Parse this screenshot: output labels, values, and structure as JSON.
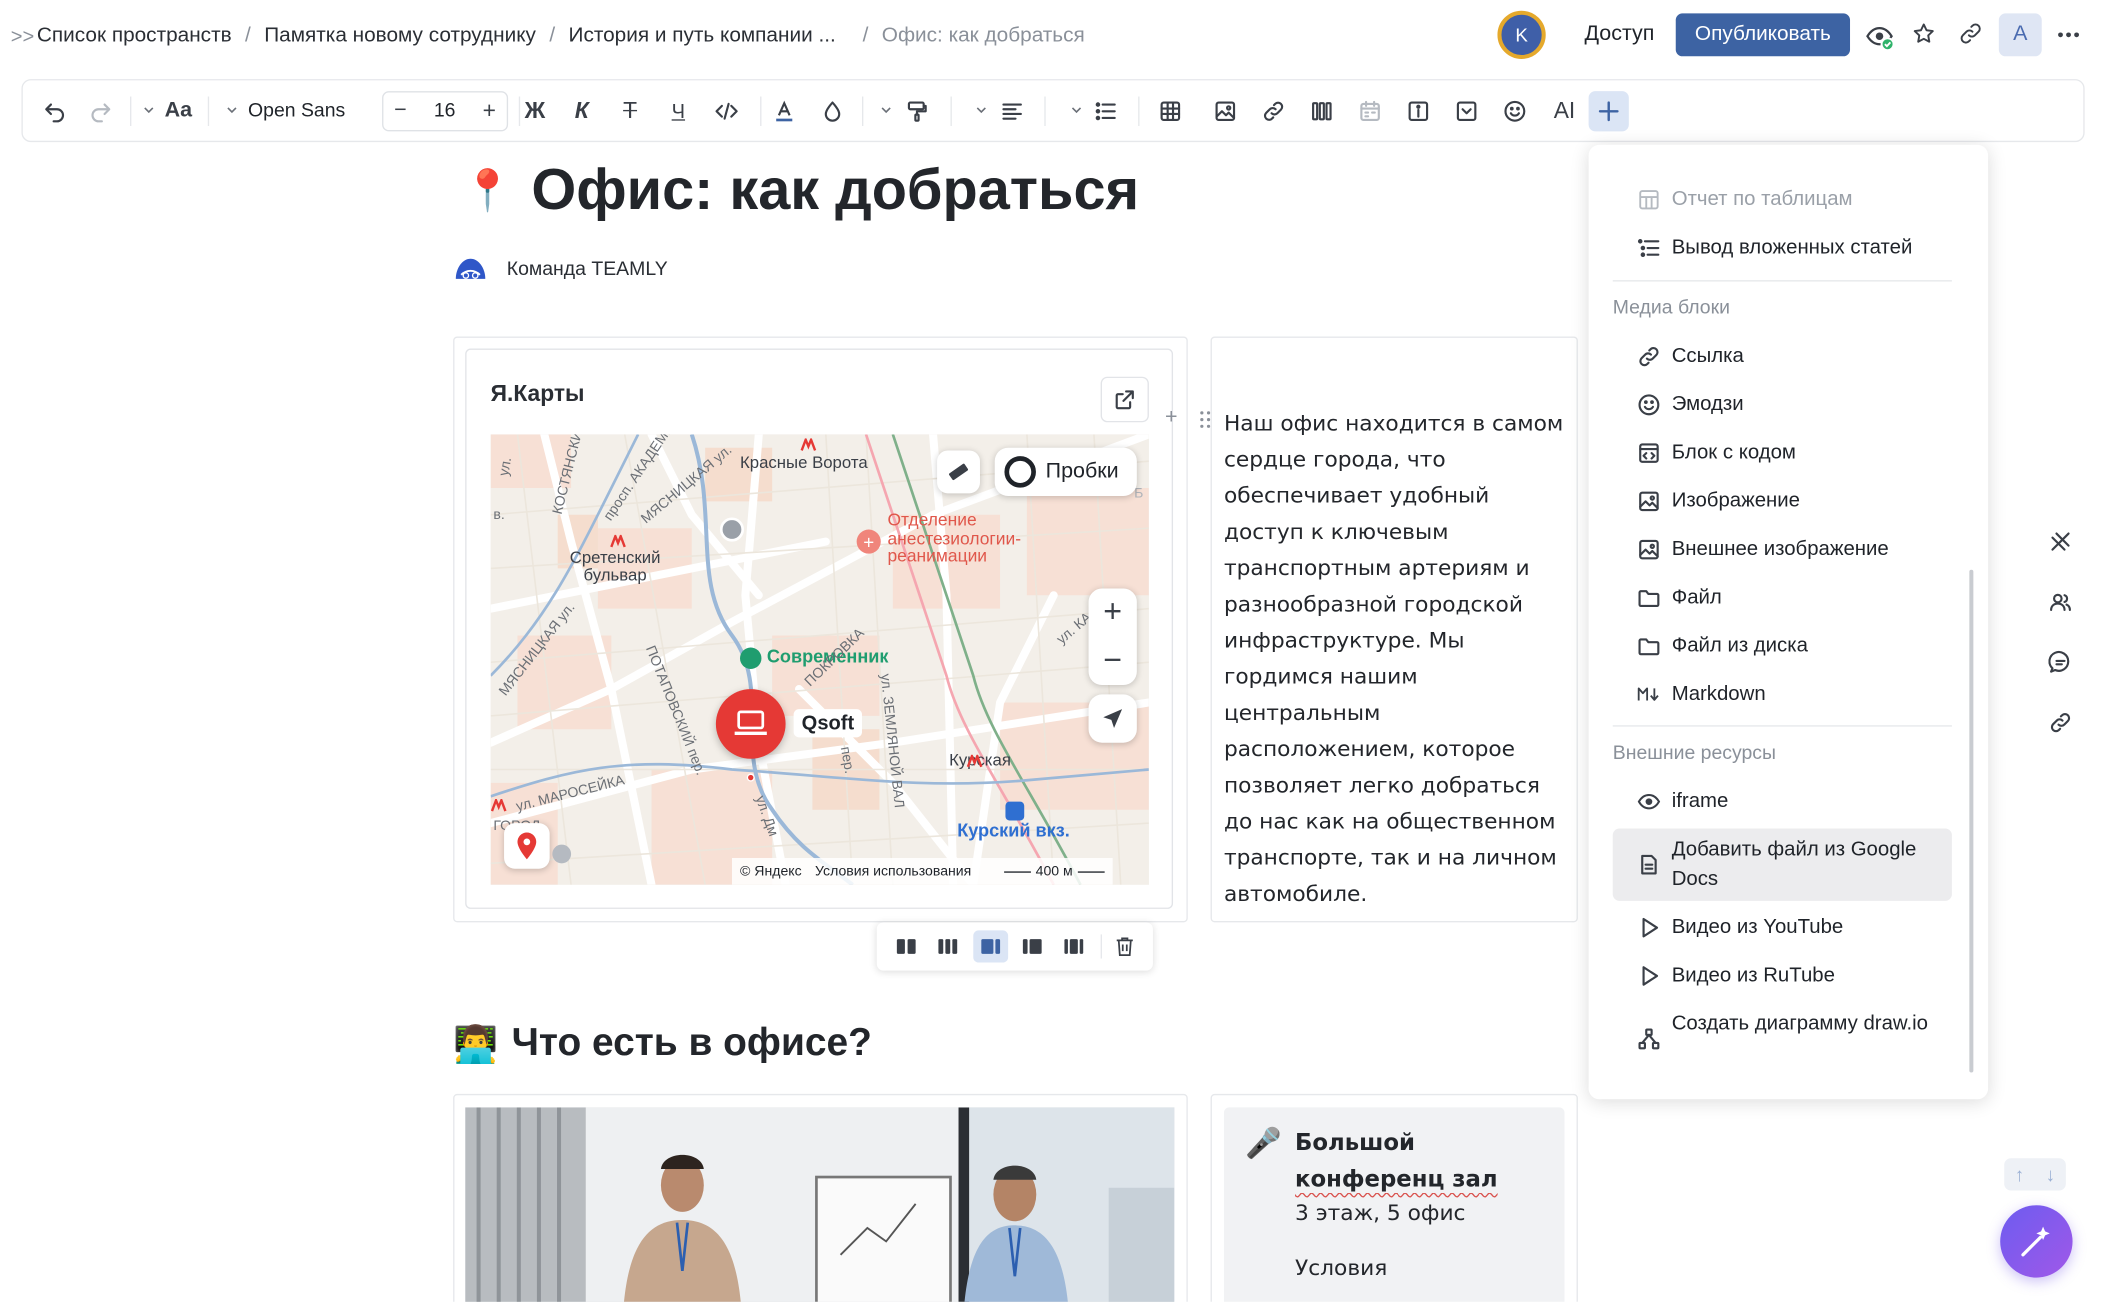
{
  "breadcrumb": {
    "items": [
      "Список пространств",
      "Памятка новому сотруднику",
      "История и путь компании ...",
      "Офис: как добраться"
    ],
    "separator": "/"
  },
  "header": {
    "user_avatar_initial": "K",
    "access_label": "Доступ",
    "publish_label": "Опубликовать",
    "account_avatar_initial": "A"
  },
  "toolbar": {
    "font_family": "Open Sans",
    "font_size": "16",
    "bold": "Ж",
    "italic": "К",
    "strike": "Т",
    "underline": "Ч",
    "ai_label": "AI",
    "font_icon_label": "Aa"
  },
  "document": {
    "title": "Офис: как добраться",
    "title_emoji": "📍",
    "author": "Команда TEAMLY",
    "paragraph": "Наш офис находится в самом сердце города, что обеспечивает удобный доступ к ключевым транспортным артериям и разнообразной городской инфраструктуре. Мы гордимся нашим центральным расположением, которое позволяет легко добраться до нас как на общественном транспорте, так и на личном автомобиле.",
    "section_title": "Что есть в офисе?",
    "section_emoji": "👨‍💻",
    "info_card": {
      "title_line1": "Большой",
      "title_line2": "конференц зал",
      "subtitle": "3 этаж, 5 офис",
      "more": "Условия"
    }
  },
  "map_widget": {
    "title": "Я.Карты",
    "traffic_label": "Пробки",
    "labels": {
      "krasnye_vorota": "Красные Ворота",
      "sretensky": "Сретенский",
      "bulvar": "бульвар",
      "hospital_1": "Отделение",
      "hospital_2": "анестезиологии-",
      "hospital_3": "реанимации",
      "sovremennik": "Современник",
      "qsoft": "Qsoft",
      "kurskaya": "Курская",
      "kursky_vokzal": "Курский вкз.",
      "zemlyanoy_val": "ул. ЗЕМЛЯНОЙ ВАЛ",
      "maroseyka": "ул. МАРОСЕЙКА",
      "potapovsky": "ПОТАПОВСКИЙ пер.",
      "myasnitskaya": "МЯСНИЦКАЯ ул.",
      "myasnitskaya_2": "МЯСНИЦКАЯ ул.",
      "akad": "просп. АКАДЕМ.",
      "kostyansky": "КОСТЯНСКИЙ",
      "pokrovka": "ПОКРОВКА",
      "gorod": "ГОРОД",
      "ul_left": "ул.",
      "v_left": "в.",
      "ul_right": "ул. КА",
      "b_right": "Б",
      "per": "пер.",
      "ul_dm": "ул. Дм"
    },
    "copyright": "© Яндекс",
    "terms": "Условия использования",
    "scale": "400 м",
    "zoom_in": "+",
    "zoom_out": "−"
  },
  "insert_menu": {
    "top_items": [
      {
        "label": "Отчет по таблицам",
        "icon": "table-report-icon",
        "disabled": true
      },
      {
        "label": "Вывод вложенных статей",
        "icon": "nested-list-icon",
        "disabled": false
      }
    ],
    "media_section": "Медиа блоки",
    "media_items": [
      {
        "label": "Ссылка",
        "icon": "link-icon"
      },
      {
        "label": "Эмодзи",
        "icon": "emoji-icon"
      },
      {
        "label": "Блок с кодом",
        "icon": "code-block-icon"
      },
      {
        "label": "Изображение",
        "icon": "image-icon"
      },
      {
        "label": "Внешнее изображение",
        "icon": "external-image-icon"
      },
      {
        "label": "Файл",
        "icon": "folder-icon"
      },
      {
        "label": "Файл из диска",
        "icon": "folder-disk-icon"
      },
      {
        "label": "Markdown",
        "icon": "markdown-icon"
      }
    ],
    "external_section": "Внешние ресурсы",
    "external_items": [
      {
        "label": "iframe",
        "icon": "eye-icon"
      },
      {
        "label": "Добавить файл из Google Docs",
        "icon": "document-icon"
      },
      {
        "label": "Видео из YouTube",
        "icon": "play-icon"
      },
      {
        "label": "Видео из RuTube",
        "icon": "play-icon"
      },
      {
        "label": "Создать диаграмму draw.io",
        "icon": "diagram-icon"
      }
    ]
  },
  "colors": {
    "accent": "#3d63a3",
    "publish_bg": "#3d63a3",
    "menu_selected": "#ececee",
    "map_red": "#e53935",
    "map_green": "#1f9d6f",
    "map_blue": "#2f6fd1"
  }
}
